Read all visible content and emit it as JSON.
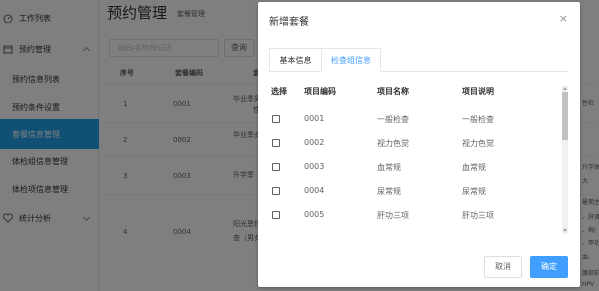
{
  "sidebar": {
    "items": [
      {
        "label": "工作列表"
      },
      {
        "label": "预约管理"
      },
      {
        "label": "统计分析"
      }
    ],
    "sub_items": [
      {
        "label": "预约信息列表"
      },
      {
        "label": "预约条件设置"
      },
      {
        "label": "套餐信息管理"
      },
      {
        "label": "体检组信息管理"
      },
      {
        "label": "体检项信息管理"
      }
    ]
  },
  "page": {
    "title": "预约管理",
    "subtitle": "套餐管理",
    "search_placeholder": "编码/名称/助记码",
    "search_button": "查询",
    "table_headers": [
      "序号",
      "套餐编码",
      "套"
    ],
    "rows": [
      {
        "index": "1",
        "code": "0001",
        "desc": "毕业季男"
      },
      {
        "index": "2",
        "code": "0002",
        "desc": "毕业季女"
      },
      {
        "index": "3",
        "code": "0003",
        "desc": "升学季"
      },
      {
        "index": "4",
        "code": "0004",
        "desc": "阳光恩铛"
      }
    ],
    "row_desc_extra": [
      "性检",
      "",
      "",
      "查（男女"
    ]
  },
  "dialog": {
    "title": "新增套餐",
    "close": "×",
    "tabs": [
      {
        "label": "基本信息"
      },
      {
        "label": "检查组信息"
      }
    ],
    "headers": [
      "选择",
      "项目编码",
      "项目名称",
      "项目说明"
    ],
    "rows": [
      {
        "code": "0001",
        "name": "一般检查",
        "desc": "一般检查"
      },
      {
        "code": "0002",
        "name": "视力色觉",
        "desc": "视力色觉"
      },
      {
        "code": "0003",
        "name": "血常规",
        "desc": "血常规"
      },
      {
        "code": "0004",
        "name": "尿常规",
        "desc": "尿常规"
      },
      {
        "code": "0005",
        "name": "肝功三项",
        "desc": "肝功三项"
      }
    ],
    "cancel": "取消",
    "ok": "确定"
  },
  "right_strip": [
    "性检",
    "",
    "升学体",
    "大",
    "",
    "",
    "暑期主要",
    "、肝肾",
    "、梅/",
    "、甲功",
    "血、",
    "",
    "",
    "腹部彩",
    "HPV"
  ],
  "colors": {
    "active": "#1ea0e8",
    "primary": "#409eff",
    "overlay": "rgba(0,0,0,0.5)"
  }
}
